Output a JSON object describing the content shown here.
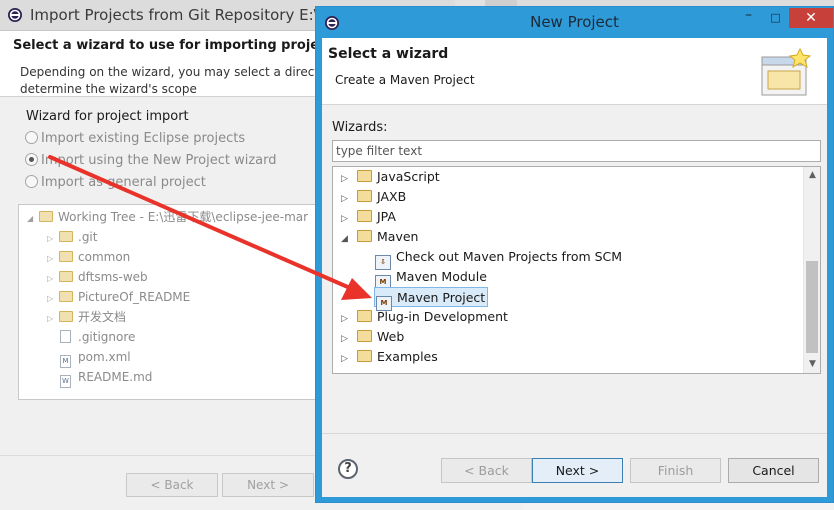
{
  "background_window": {
    "title": "Import Projects from Git Repository E:\\",
    "header_title": "Select a wizard to use for importing projects",
    "header_desc_line1": "Depending on the wizard, you may select a directo",
    "header_desc_line2": "determine the wizard's scope",
    "group_label": "Wizard for project import",
    "radios": [
      {
        "label": "Import existing Eclipse projects",
        "checked": false
      },
      {
        "label": "Import using the New Project wizard",
        "checked": true
      },
      {
        "label": "Import as general project",
        "checked": false
      }
    ],
    "tree": [
      {
        "label": "Working Tree - E:\\迅雷下载\\eclipse-jee-mar",
        "type": "folder",
        "expanded": true
      },
      {
        "label": ".git",
        "type": "folder"
      },
      {
        "label": "common",
        "type": "folder"
      },
      {
        "label": "dftsms-web",
        "type": "folder"
      },
      {
        "label": "PictureOf_README",
        "type": "folder"
      },
      {
        "label": "开发文档",
        "type": "folder"
      },
      {
        "label": ".gitignore",
        "type": "file"
      },
      {
        "label": "pom.xml",
        "type": "file",
        "icon_text": "M"
      },
      {
        "label": "README.md",
        "type": "file",
        "icon_text": "W"
      }
    ],
    "buttons": {
      "back": "< Back",
      "next": "Next >"
    }
  },
  "new_project": {
    "title": "New Project",
    "header_title": "Select a wizard",
    "header_desc": "Create a Maven Project",
    "wizards_label": "Wizards:",
    "filter_placeholder": "type filter text",
    "tree": [
      {
        "label": "JavaScript",
        "type": "folder",
        "expanded": false
      },
      {
        "label": "JAXB",
        "type": "folder",
        "expanded": false
      },
      {
        "label": "JPA",
        "type": "folder",
        "expanded": false
      },
      {
        "label": "Maven",
        "type": "folder",
        "expanded": true
      },
      {
        "label": "Check out Maven Projects from SCM",
        "type": "item",
        "icon": "scm-checkout-icon"
      },
      {
        "label": "Maven Module",
        "type": "item",
        "icon": "maven-module-icon"
      },
      {
        "label": "Maven Project",
        "type": "item",
        "icon": "maven-project-icon",
        "selected": true
      },
      {
        "label": "Plug-in Development",
        "type": "folder",
        "expanded": false
      },
      {
        "label": "Web",
        "type": "folder",
        "expanded": false
      },
      {
        "label": "Examples",
        "type": "folder",
        "expanded": false
      }
    ],
    "buttons": {
      "help": "?",
      "back": "< Back",
      "next": "Next >",
      "finish": "Finish",
      "cancel": "Cancel"
    },
    "window_controls": {
      "minimize": "–",
      "maximize": "□",
      "close": "✕"
    }
  },
  "colors": {
    "titlebar_active": "#2f9ad8",
    "close_button": "#c7403a",
    "selection": "#d9ebf9",
    "annotation_arrow": "#e8322a"
  }
}
